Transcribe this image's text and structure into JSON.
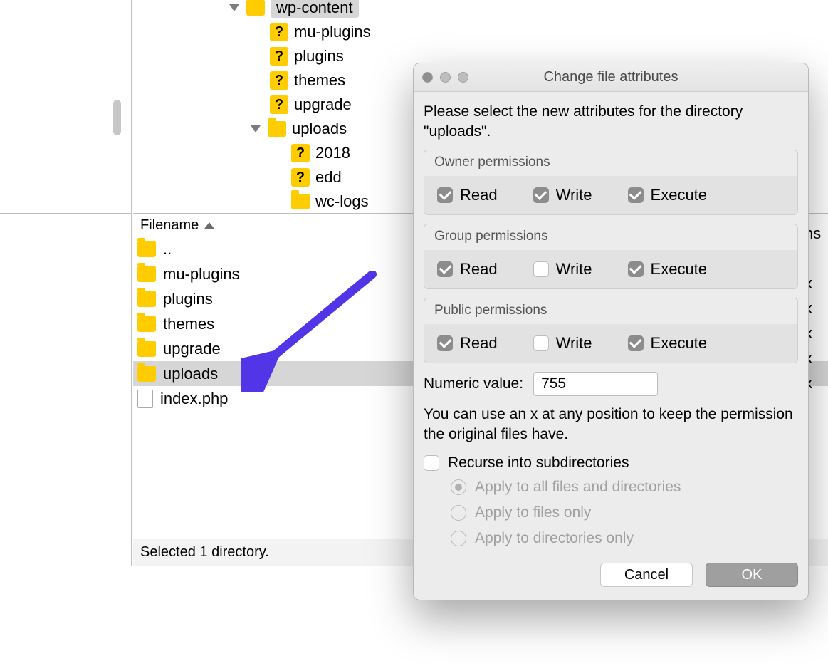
{
  "tree": {
    "root": {
      "label": "wp-content",
      "selected": true
    },
    "children": [
      {
        "label": "mu-plugins",
        "icon": "q"
      },
      {
        "label": "plugins",
        "icon": "q"
      },
      {
        "label": "themes",
        "icon": "q"
      },
      {
        "label": "upgrade",
        "icon": "q"
      },
      {
        "label": "uploads",
        "icon": "folder",
        "expanded": true,
        "children": [
          {
            "label": "2018",
            "icon": "q"
          },
          {
            "label": "edd",
            "icon": "q"
          },
          {
            "label": "wc-logs",
            "icon": "folder"
          }
        ]
      }
    ]
  },
  "list": {
    "header": "Filename",
    "rows": [
      {
        "name": "..",
        "icon": "folder",
        "selected": false
      },
      {
        "name": "mu-plugins",
        "icon": "folder",
        "selected": false
      },
      {
        "name": "plugins",
        "icon": "folder",
        "selected": false
      },
      {
        "name": "themes",
        "icon": "folder",
        "selected": false
      },
      {
        "name": "upgrade",
        "icon": "folder",
        "selected": false
      },
      {
        "name": "uploads",
        "icon": "folder",
        "selected": true
      },
      {
        "name": "index.php",
        "icon": "file",
        "selected": false
      }
    ],
    "status": "Selected 1 directory."
  },
  "right_column": {
    "header_fragment": "ns",
    "cells": [
      "",
      "x",
      "x",
      "x",
      "x",
      "x",
      ""
    ]
  },
  "dialog": {
    "title": "Change file attributes",
    "instruction": "Please select the new attributes for the directory \"uploads\".",
    "groups": [
      {
        "title": "Owner permissions",
        "read": true,
        "write": true,
        "execute": true
      },
      {
        "title": "Group permissions",
        "read": true,
        "write": false,
        "execute": true
      },
      {
        "title": "Public permissions",
        "read": true,
        "write": false,
        "execute": true
      }
    ],
    "perm_labels": {
      "read": "Read",
      "write": "Write",
      "execute": "Execute"
    },
    "numeric_label": "Numeric value:",
    "numeric_value": "755",
    "hint": "You can use an x at any position to keep the permission the original files have.",
    "recurse_label": "Recurse into subdirectories",
    "recurse_checked": false,
    "radios": [
      {
        "label": "Apply to all files and directories",
        "selected": true
      },
      {
        "label": "Apply to files only",
        "selected": false
      },
      {
        "label": "Apply to directories only",
        "selected": false
      }
    ],
    "buttons": {
      "cancel": "Cancel",
      "ok": "OK"
    }
  }
}
